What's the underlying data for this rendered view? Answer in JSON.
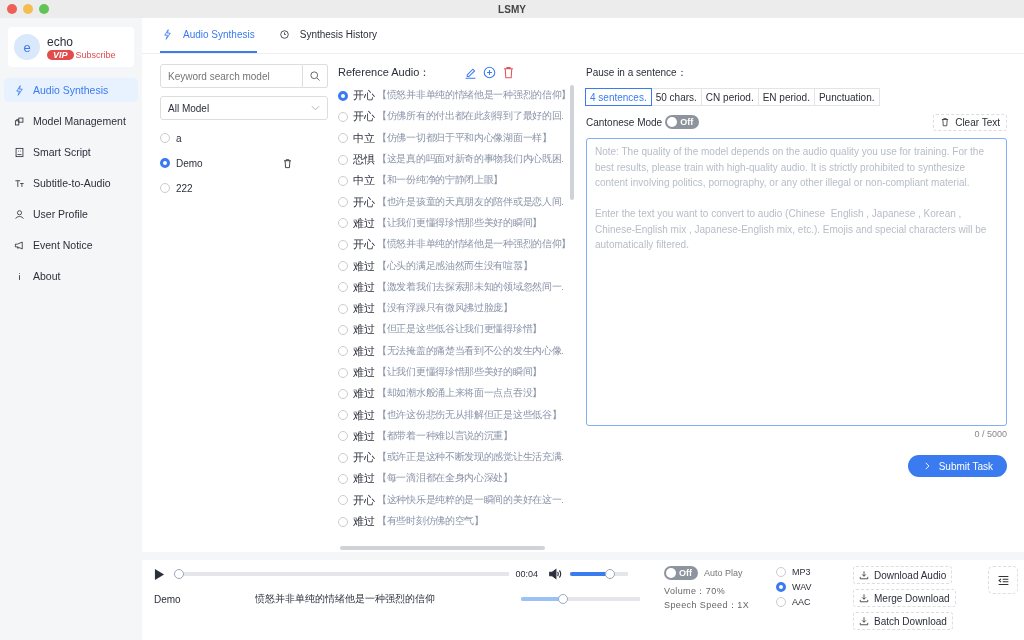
{
  "window": {
    "title": "LSMY"
  },
  "user": {
    "avatar": "e",
    "name": "echo",
    "badge": "VIP",
    "link": "Subscribe"
  },
  "sidebar": {
    "items": [
      {
        "kind": "synthesis",
        "label": "Audio Synthesis",
        "selected": true
      },
      {
        "kind": "models",
        "label": "Model Management",
        "selected": false
      },
      {
        "kind": "script",
        "label": "Smart Script",
        "selected": false
      },
      {
        "kind": "subtitle",
        "label": "Subtitle-to-Audio",
        "selected": false
      },
      {
        "kind": "profile",
        "label": "User Profile",
        "selected": false
      },
      {
        "kind": "notice",
        "label": "Event Notice",
        "selected": false
      },
      {
        "kind": "about",
        "label": "About",
        "selected": false
      }
    ]
  },
  "tabs": [
    {
      "kind": "synthesis",
      "label": "Audio Synthesis",
      "selected": true
    },
    {
      "kind": "history",
      "label": "Synthesis History",
      "selected": false
    }
  ],
  "models": {
    "search": {
      "placeholder": "Keyword search model"
    },
    "filter": "All Model",
    "items": [
      {
        "name": "a",
        "selected": false
      },
      {
        "name": "Demo",
        "selected": true
      },
      {
        "name": "222",
        "selected": false
      }
    ]
  },
  "reference": {
    "label": "Reference Audio：",
    "items": [
      {
        "mood": "开心",
        "text": "【愤怒并非单纯的情绪他是一种强烈的信仰】",
        "selected": true
      },
      {
        "mood": "开心",
        "text": "【仿佛所有的付出都在此刻得到了最好的回.",
        "selected": false
      },
      {
        "mood": "中立",
        "text": "【仿佛一切都归于平和内心像湖面一样】",
        "selected": false
      },
      {
        "mood": "恐惧",
        "text": "【这是真的吗面对新奇的事物我们内心既困.",
        "selected": false
      },
      {
        "mood": "中立",
        "text": "【和一份纯净的宁静闭上眼】",
        "selected": false
      },
      {
        "mood": "开心",
        "text": "【也许是孩童的天真朋友的陪伴或是恋人间.",
        "selected": false
      },
      {
        "mood": "难过",
        "text": "【让我们更懂得珍惜那些美好的瞬间】",
        "selected": false
      },
      {
        "mood": "开心",
        "text": "【愤怒并非单纯的情绪他是一种强烈的信仰】",
        "selected": false
      },
      {
        "mood": "难过",
        "text": "【心头的满足感油然而生没有喧嚣】",
        "selected": false
      },
      {
        "mood": "难过",
        "text": "【激发着我们去探索那未知的领域忽然间一.",
        "selected": false
      },
      {
        "mood": "难过",
        "text": "【没有浮躁只有微风拂过脸庞】",
        "selected": false
      },
      {
        "mood": "难过",
        "text": "【但正是这些低谷让我们更懂得珍惜】",
        "selected": false
      },
      {
        "mood": "难过",
        "text": "【无法掩盖的痛楚当看到不公的发生内心像.",
        "selected": false
      },
      {
        "mood": "难过",
        "text": "【让我们更懂得珍惜那些美好的瞬间】",
        "selected": false
      },
      {
        "mood": "难过",
        "text": "【却如潮水般涌上来将面一点点吞没】",
        "selected": false
      },
      {
        "mood": "难过",
        "text": "【也许这份悲伤无从排解但正是这些低谷】",
        "selected": false
      },
      {
        "mood": "难过",
        "text": "【都带着一种难以言说的沉重】",
        "selected": false
      },
      {
        "mood": "开心",
        "text": "【或许正是这种不断发现的感觉让生活充满.",
        "selected": false
      },
      {
        "mood": "难过",
        "text": "【每一滴泪都在全身内心深处】",
        "selected": false
      },
      {
        "mood": "开心",
        "text": "【这种快乐是纯粹的是一瞬间的美好在这一.",
        "selected": false
      },
      {
        "mood": "难过",
        "text": "【有些时刻仿佛的空气】",
        "selected": false
      }
    ]
  },
  "settings": {
    "pause_label": "Pause in a sentence：",
    "pause_options": [
      {
        "label": "4 sentences.",
        "selected": true
      },
      {
        "label": "50 chars.",
        "selected": false
      },
      {
        "label": "CN period.",
        "selected": false
      },
      {
        "label": "EN period.",
        "selected": false
      },
      {
        "label": "Punctuation.",
        "selected": false
      }
    ],
    "cantonese": {
      "label": "Cantonese Mode",
      "on": false,
      "state_text": "Off"
    },
    "clear_button": "Clear Text",
    "text": {
      "placeholder": "Note: The quality of the model depends on the audio quality you use for training. For the best results, please train with high-quality audio. It is strictly prohibited to synthesize content involving politics, pornography, or any other illegal or non-compliant material.\n\nEnter the text you want to convert to audio (Chinese  English , Japanese , Korean , Chinese-English mix , Japanese-English mix, etc.). Emojis and special characters will be automatically filtered."
    },
    "counter": "0 / 5000",
    "submit": "Submit Task"
  },
  "player": {
    "progress": {
      "level": 0
    },
    "time": "00:04",
    "volume": {
      "level": 0.72
    },
    "model": "Demo",
    "text": "愤怒并非单纯的情绪他是一种强烈的信仰",
    "speed": {
      "level": 0.34
    },
    "auto_play": {
      "label": "Auto Play",
      "on": false,
      "state_text": "Off"
    },
    "volume_text": "Volume：70%",
    "speed_text": "Speech Speed：1X",
    "formats": [
      {
        "label": "MP3",
        "selected": false
      },
      {
        "label": "WAV",
        "selected": true
      },
      {
        "label": "AAC",
        "selected": false
      }
    ],
    "downloads": [
      "Download Audio",
      "Merge Download",
      "Batch Download"
    ]
  }
}
